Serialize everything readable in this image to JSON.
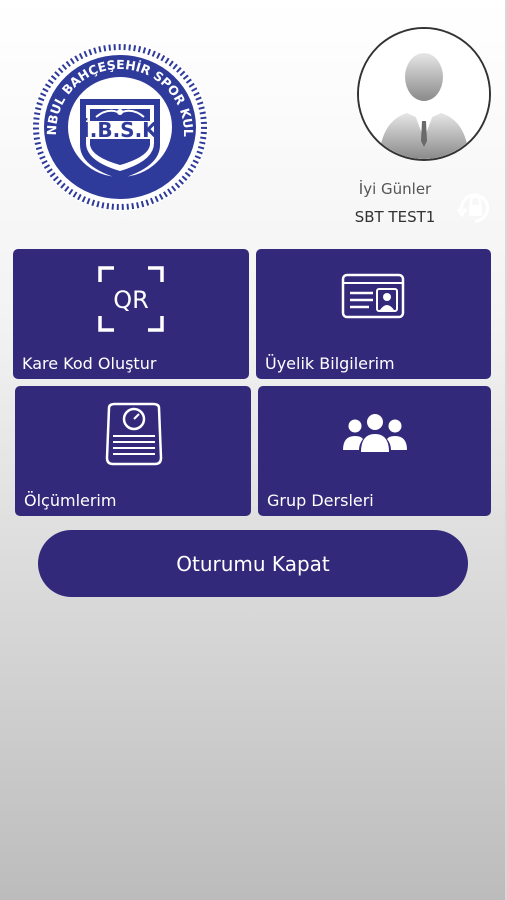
{
  "logo": {
    "ring_text": "İSTANBUL BAHÇEŞEHİR SPOR KULÜBÜ",
    "initials": "İ.B.S.K",
    "year": "2013"
  },
  "profile": {
    "greeting": "İyi Günler",
    "username": "SBT TEST1",
    "avatar_icon": "user-silhouette-icon",
    "lock_icon": "lock-refresh-icon"
  },
  "tiles": [
    {
      "label": "Kare Kod Oluştur",
      "icon": "qr-code-icon",
      "icon_text": "QR"
    },
    {
      "label": "Üyelik Bilgilerim",
      "icon": "id-card-icon"
    },
    {
      "label": "Ölçümlerim",
      "icon": "scale-icon"
    },
    {
      "label": "Grup Dersleri",
      "icon": "group-users-icon"
    }
  ],
  "logout_label": "Oturumu Kapat",
  "colors": {
    "primary": "#33297a",
    "logo_blue": "#2f3b9a"
  }
}
